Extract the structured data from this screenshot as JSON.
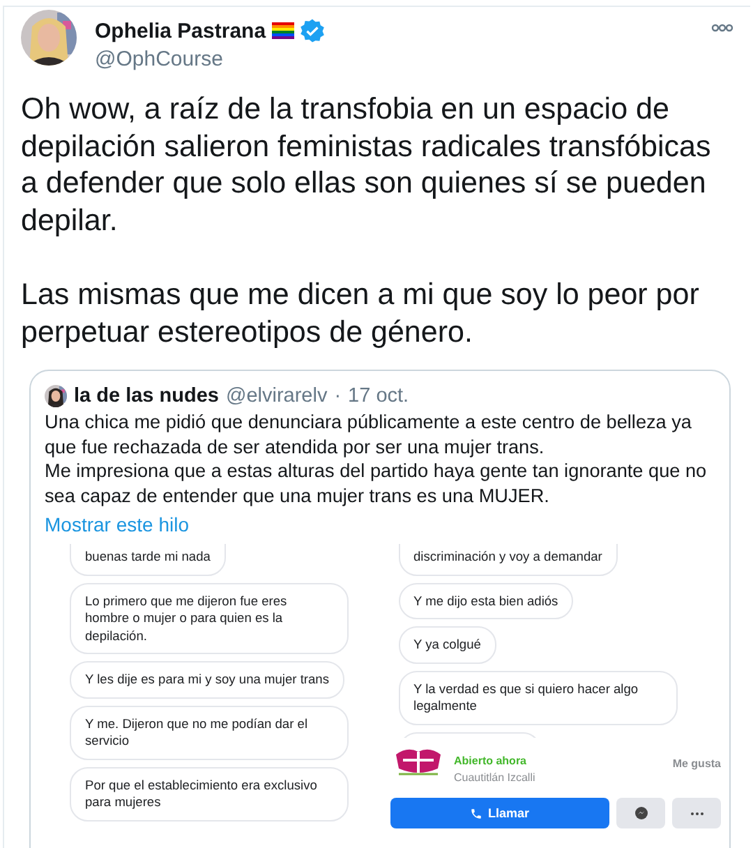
{
  "author": {
    "name": "Ophelia Pastrana",
    "handle": "@OphCourse",
    "verified": true,
    "flag": true
  },
  "text": [
    "Oh wow, a raíz de la transfobia en un espacio de depilación salieron feministas radicales transfóbicas a defender que solo ellas son quienes sí se pueden depilar.",
    "Las mismas que me dicen a mi que soy lo peor por perpetuar estereotipos de género."
  ],
  "quote": {
    "author": {
      "name": "la de las nudes",
      "handle": "@elvirarelv"
    },
    "separator": "·",
    "date": "17 oct.",
    "text": [
      "Una chica me pidió que denunciara públicamente a este centro de belleza ya que fue rechazada de ser atendida por ser una mujer trans.",
      "Me impresiona que a estas alturas del partido haya gente tan ignorante que no sea capaz de entender que una mujer trans es una MUJER."
    ],
    "show_thread": "Mostrar este hilo",
    "images": [
      {
        "bubbles": [
          "buenas tarde mi nada",
          "Lo primero que me dijeron fue eres hombre o mujer o para quien es la depilación.",
          "Y les dije es para mi y soy una mujer trans",
          "Y me. Dijeron que no me podían dar el servicio",
          "Por que el establecimiento era exclusivo para mujeres"
        ]
      },
      {
        "bubbles": [
          "discriminación y voy a demandar",
          "Y me dijo esta bien adiós",
          "Y ya colgué",
          "Y la verdad es que si quiero hacer algo legalmente"
        ],
        "page": {
          "status": "Abierto ahora",
          "location": "Cuautitlán Izcalli",
          "like": "Me gusta",
          "call": "Llamar"
        }
      }
    ]
  }
}
